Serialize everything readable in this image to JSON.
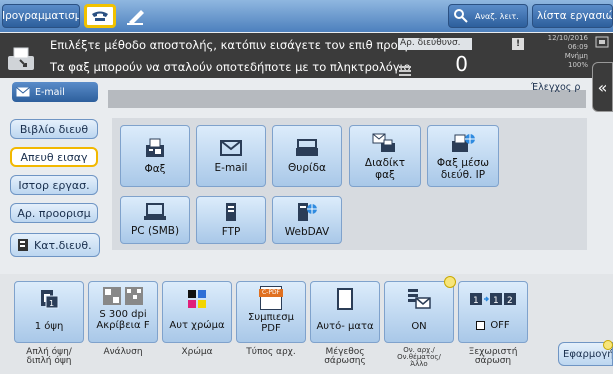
{
  "top": {
    "program": "Προγραμματισμ.",
    "search": "Αναζ. λειτ.",
    "jobs": "λίστα εργασιών"
  },
  "message": {
    "line1": "Επιλέξτε μέθοδο αποστολής, κατόπιν εισάγετε τον επιθ προορ.",
    "line2": "Τα φαξ μπορούν να σταλούν οποτεδήποτε με το πληκτρολόγιο",
    "dest_label": "Αρ. διεύθυνσ.",
    "dest_count": "0",
    "date": "12/10/2016",
    "time": "06:09",
    "memory_label": "Μνήμη",
    "memory_value": "100%"
  },
  "email_tab": "E-mail",
  "check_button": "Έλεγχος ρ",
  "sidebar": [
    "Βιβλίο διευθ",
    "Απευθ εισαγ",
    "Ιστορ εργασ.",
    "Αρ. προορισμ",
    "Κατ.διευθ."
  ],
  "tiles": {
    "fax": "Φαξ",
    "email": "E-mail",
    "box": "Θυρίδα",
    "ifax1": "Διαδίκτ",
    "ifax2": "φαξ",
    "ipfax1": "Φαξ μέσω",
    "ipfax2": "διεύθ. IP",
    "pc": "PC (SMB)",
    "ftp": "FTP",
    "webdav": "WebDAV"
  },
  "bottom": [
    {
      "value": "1 όψη",
      "caption1": "Απλή όψη/",
      "caption2": "διπλή όψη"
    },
    {
      "value1": "S 300 dpi",
      "value2": "Ακρίβεια F",
      "caption1": "Ανάλυση"
    },
    {
      "value": "Αυτ χρώμα",
      "caption1": "Χρώμα"
    },
    {
      "value1": "Συμπιεσμ",
      "value2": "PDF",
      "caption1": "Τύπος αρχ.",
      "badge": "C-PDF"
    },
    {
      "value": "Αυτό- ματα",
      "caption1": "Μέγεθος",
      "caption2": "σάρωσης"
    },
    {
      "value": "ON",
      "caption1": "Ον. αρχ./",
      "caption2": "Ον.θέματος/",
      "caption3": "Άλλο"
    },
    {
      "value": "OFF",
      "caption1": "Ξεχωριστή",
      "caption2": "σάρωση"
    }
  ],
  "apply": "Εφαρμογή",
  "colors": {
    "accent": "#3d73b8",
    "selected": "#f2b800",
    "message_bg": "#3b3b3b"
  }
}
